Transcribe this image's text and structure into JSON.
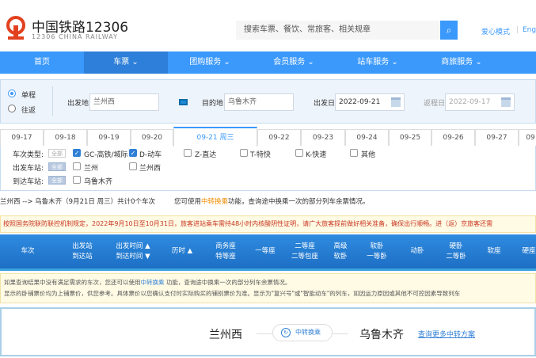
{
  "header": {
    "logo_title": "中国铁路12306",
    "logo_subtitle": "12306 CHINA RAILWAY",
    "search_placeholder": "搜索车票、餐饮、常旅客、相关规章",
    "links": [
      "爱心模式",
      "Engl"
    ]
  },
  "nav": [
    {
      "label": "首页"
    },
    {
      "label": "车票 ⌄"
    },
    {
      "label": "团购服务 ⌄"
    },
    {
      "label": "会员服务 ⌄"
    },
    {
      "label": "站车服务 ⌄"
    },
    {
      "label": "商旅服务 ⌄"
    }
  ],
  "search_panel": {
    "trip_types": [
      "单程",
      "往返"
    ],
    "selected_trip": "单程",
    "from_label": "出发地",
    "from_value": "兰州西",
    "to_label": "目的地",
    "to_value": "乌鲁木齐",
    "depart_label": "出发日",
    "depart_value": "2022-09-21",
    "return_label": "返程日",
    "return_value": "2022-09-17"
  },
  "date_tabs": [
    "09-17",
    "09-18",
    "09-19",
    "09-20",
    "09-21 周三",
    "09-22",
    "09-23",
    "09-24",
    "09-25",
    "09-26",
    "09-27",
    "09"
  ],
  "filters": {
    "all_label": "全部",
    "train_type_label": "车次类型:",
    "train_types": [
      {
        "label": "GC-高铁/城际",
        "checked": true
      },
      {
        "label": "D-动车",
        "checked": true
      },
      {
        "label": "Z-直达",
        "checked": false
      },
      {
        "label": "T-特快",
        "checked": false
      },
      {
        "label": "K-快速",
        "checked": false
      },
      {
        "label": "其他",
        "checked": false
      }
    ],
    "depart_station_label": "出发车站:",
    "depart_stations": [
      "兰州",
      "兰州西"
    ],
    "arrive_station_label": "到达车站:",
    "arrive_stations": [
      "乌鲁木齐"
    ]
  },
  "summary": {
    "route": "兰州西 --> 乌鲁木齐（9月21日  周三）共计0个车次",
    "hint_pre": "您可使用",
    "hint_link": "中转换乘",
    "hint_post": "功能，查询途中换乘一次的部分列车余票情况。"
  },
  "notice": "按照国务院联防联控机制规定，2022年9月10日至10月31日，旅客进站乘车需持48小时内核酸阴性证明，请广大旅客提前做好相关准备，确保出行顺畅。进（返）京旅客还需",
  "table_headers": [
    [
      "车次"
    ],
    [
      "出发站",
      "到达站"
    ],
    [
      "出发时间 ▲",
      "到达时间 ▼"
    ],
    [
      "历时 ▲"
    ],
    [
      "商务座",
      "特等座"
    ],
    [
      "一等座"
    ],
    [
      "二等座",
      "二等包座"
    ],
    [
      "高级",
      "软卧"
    ],
    [
      "软卧",
      "一等卧"
    ],
    [
      "动卧"
    ],
    [
      "硬卧",
      "二等卧"
    ],
    [
      "软座"
    ],
    [
      "硬座"
    ]
  ],
  "info": {
    "line1_pre": "如果查询结果中没有满足需求的车次，您还可以使用",
    "line1_link": "中转换乘",
    "line1_post": " 功能，查询途中换乘一次的部分列车余票情况。",
    "line2": "显示的卧铺票价均为上铺票价，供您参考。具体票价以您确认支付时实际购买的铺别票价为准。显示为\"复兴号\"或\"智能动车\"的列车，如因运力原因或其他不可控因素导致列车"
  },
  "transfer": {
    "from": "兰州西",
    "button": "中转换乘",
    "to": "乌鲁木齐",
    "more_link": "查询更多中转方案"
  }
}
